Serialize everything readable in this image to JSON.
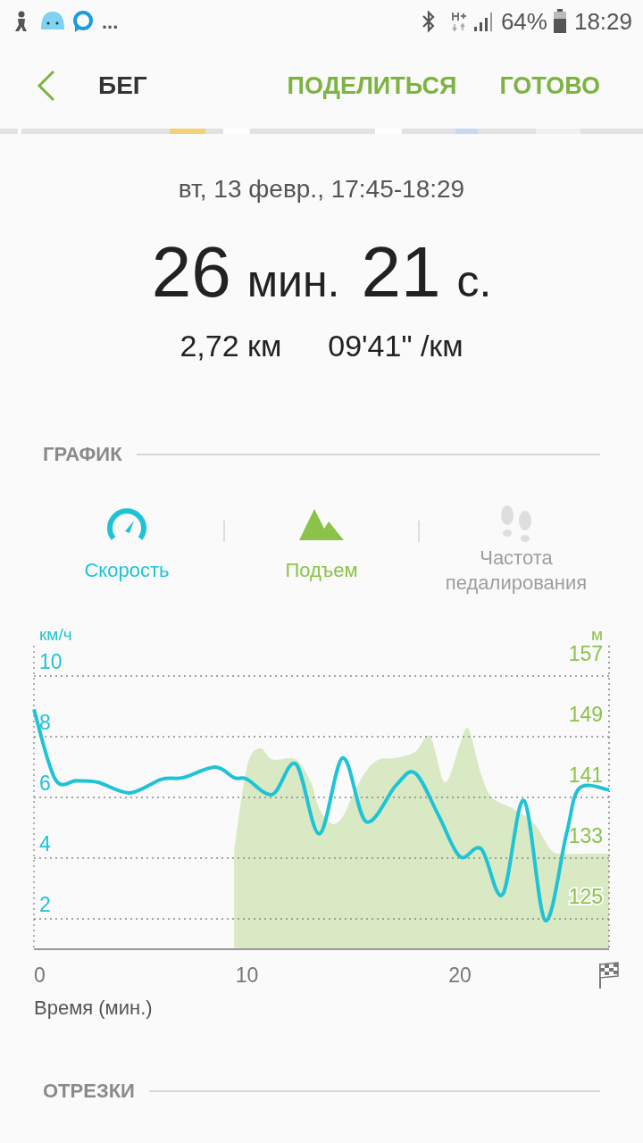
{
  "status_bar": {
    "more": "...",
    "battery": "64%",
    "time": "18:29"
  },
  "header": {
    "title": "БЕГ",
    "actions": [
      "ПОДЕЛИТЬСЯ",
      "ГОТОВО"
    ]
  },
  "summary": {
    "date": "вт, 13 февр., 17:45-18:29",
    "duration": [
      {
        "value": "26",
        "unit": "мин."
      },
      {
        "value": "21",
        "unit": "с."
      }
    ],
    "distance": "2,72 км",
    "pace": "09'41\" /км"
  },
  "graph": {
    "title": "ГРАФИК",
    "metrics": [
      {
        "kind": "speed",
        "label": "Скорость",
        "on": true,
        "color": "#1fc3d6"
      },
      {
        "kind": "elevation",
        "label": "Подъем",
        "on": true,
        "color": "#8bc34a"
      },
      {
        "kind": "cadence",
        "label": "Частота педалирования",
        "on": false,
        "color": "#9e9e9e"
      }
    ],
    "chart_data": {
      "type": "line",
      "xlabel": "Время (мин.)",
      "ylabel": "км/ч",
      "x": [
        0,
        1,
        2,
        3,
        4.5,
        6,
        7,
        8.5,
        9.4,
        10,
        11.2,
        12.3,
        13.4,
        14.5,
        15.6,
        17,
        17.9,
        19,
        20,
        21,
        22,
        23,
        24,
        25,
        25.6,
        27
      ],
      "series": [
        {
          "color": "#1fc3d6",
          "values": [
            8.9,
            6.6,
            6.55,
            6.5,
            6.15,
            6.6,
            6.65,
            7.0,
            6.65,
            6.6,
            6.1,
            7.1,
            4.8,
            7.3,
            5.2,
            6.4,
            6.8,
            5.4,
            4.05,
            4.3,
            2.8,
            5.9,
            1.95,
            4.8,
            6.3,
            6.25
          ]
        }
      ],
      "xlim": [
        0,
        27
      ],
      "ylim": [
        1,
        11
      ],
      "xticks": [
        0,
        10,
        20
      ],
      "yticks": [
        2,
        4,
        6,
        8,
        10
      ],
      "grid": true
    },
    "elevation": {
      "chart_data": {
        "type": "area",
        "ylabel": "м",
        "x": [
          9.4,
          10,
          10.6,
          11.2,
          12.3,
          13,
          13.4,
          14,
          14.5,
          15,
          15.6,
          16.2,
          17,
          17.9,
          18.6,
          19.3,
          20,
          20.4,
          21,
          21.5,
          22.5,
          23.5,
          24.3,
          25,
          26,
          27
        ],
        "series": [
          {
            "color": "#8bc34a",
            "values": [
              134,
              145,
              147.5,
              146,
              146,
              143,
              139.5,
              137.5,
              138.5,
              141.5,
              144.5,
              146,
              146.2,
              147,
              149,
              143,
              148,
              150,
              144,
              141,
              139.5,
              137.5,
              134,
              133.6,
              133.6,
              133.6
            ]
          }
        ],
        "xlim": [
          0,
          27
        ],
        "ylim": [
          121,
          161
        ],
        "yticks": [
          125,
          133,
          141,
          149,
          157
        ]
      }
    }
  },
  "segments": {
    "title": "ОТРЕЗКИ"
  }
}
